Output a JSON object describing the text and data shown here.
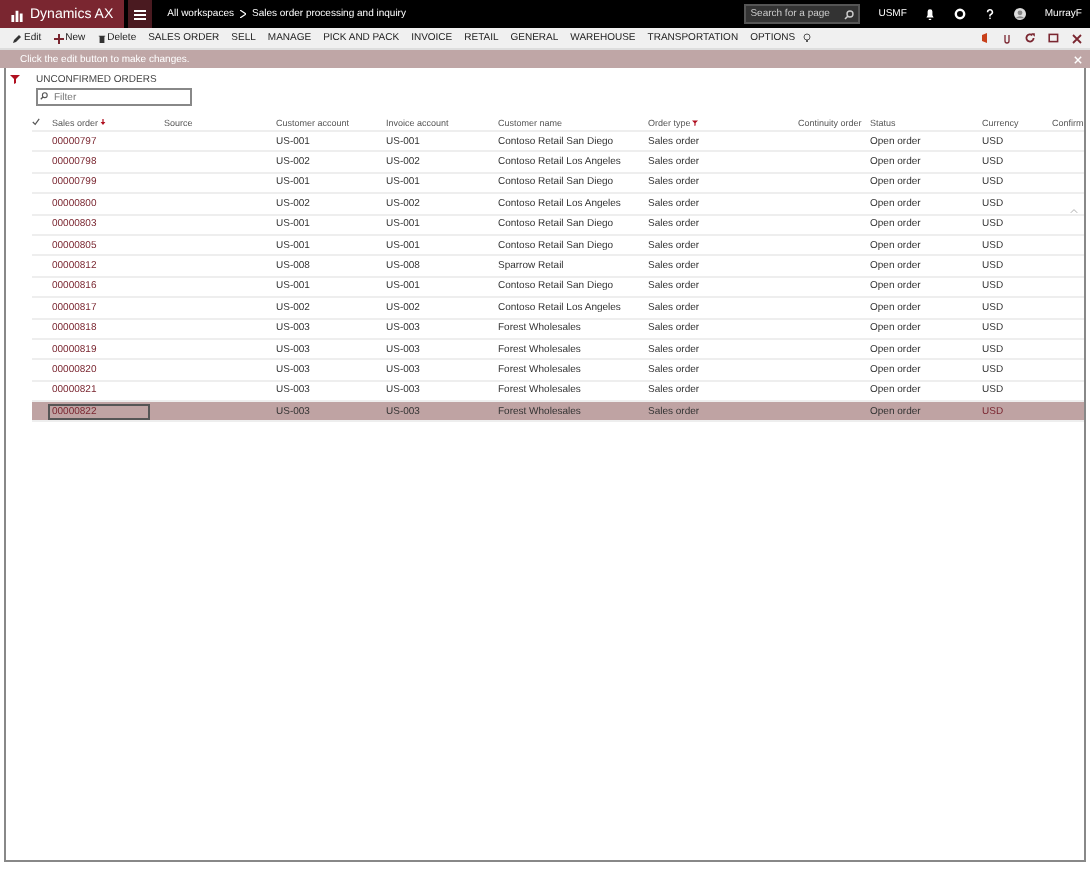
{
  "app": {
    "title": "Dynamics AX"
  },
  "breadcrumb": [
    "All workspaces",
    "Sales order processing and inquiry"
  ],
  "search": {
    "placeholder": "Search for a page"
  },
  "company": "USMF",
  "user": "MurrayF",
  "actions": [
    {
      "label": "Edit",
      "kind": "edit"
    },
    {
      "label": "New",
      "kind": "new"
    },
    {
      "label": "Delete",
      "kind": "delete"
    },
    {
      "label": "SALES ORDER",
      "kind": "menu"
    },
    {
      "label": "SELL",
      "kind": "menu"
    },
    {
      "label": "MANAGE",
      "kind": "menu"
    },
    {
      "label": "PICK AND PACK",
      "kind": "menu"
    },
    {
      "label": "INVOICE",
      "kind": "menu"
    },
    {
      "label": "RETAIL",
      "kind": "menu"
    },
    {
      "label": "GENERAL",
      "kind": "menu"
    },
    {
      "label": "WAREHOUSE",
      "kind": "menu"
    },
    {
      "label": "TRANSPORTATION",
      "kind": "menu"
    },
    {
      "label": "OPTIONS",
      "kind": "menu"
    }
  ],
  "message": "Click the edit button to make changes.",
  "list": {
    "title": "UNCONFIRMED ORDERS",
    "filter_placeholder": "Filter"
  },
  "columns": [
    {
      "label": "Sales order",
      "sorted": true,
      "filtered": false
    },
    {
      "label": "Source",
      "sorted": false,
      "filtered": false
    },
    {
      "label": "Customer account",
      "sorted": false,
      "filtered": false
    },
    {
      "label": "Invoice account",
      "sorted": false,
      "filtered": false
    },
    {
      "label": "Customer name",
      "sorted": false,
      "filtered": false
    },
    {
      "label": "Order type",
      "sorted": false,
      "filtered": true
    },
    {
      "label": "Continuity order",
      "sorted": false,
      "filtered": false
    },
    {
      "label": "Status",
      "sorted": false,
      "filtered": false
    },
    {
      "label": "Currency",
      "sorted": false,
      "filtered": false
    },
    {
      "label": "Confirm",
      "sorted": false,
      "filtered": false
    }
  ],
  "rows": [
    {
      "order": "00000797",
      "customer": "US-001",
      "invoice": "US-001",
      "name": "Contoso Retail San Diego",
      "type": "Sales order",
      "status": "Open order",
      "currency": "USD",
      "selected": false
    },
    {
      "order": "00000798",
      "customer": "US-002",
      "invoice": "US-002",
      "name": "Contoso Retail Los Angeles",
      "type": "Sales order",
      "status": "Open order",
      "currency": "USD",
      "selected": false
    },
    {
      "order": "00000799",
      "customer": "US-001",
      "invoice": "US-001",
      "name": "Contoso Retail San Diego",
      "type": "Sales order",
      "status": "Open order",
      "currency": "USD",
      "selected": false
    },
    {
      "order": "00000800",
      "customer": "US-002",
      "invoice": "US-002",
      "name": "Contoso Retail Los Angeles",
      "type": "Sales order",
      "status": "Open order",
      "currency": "USD",
      "selected": false
    },
    {
      "order": "00000803",
      "customer": "US-001",
      "invoice": "US-001",
      "name": "Contoso Retail San Diego",
      "type": "Sales order",
      "status": "Open order",
      "currency": "USD",
      "selected": false
    },
    {
      "order": "00000805",
      "customer": "US-001",
      "invoice": "US-001",
      "name": "Contoso Retail San Diego",
      "type": "Sales order",
      "status": "Open order",
      "currency": "USD",
      "selected": false
    },
    {
      "order": "00000812",
      "customer": "US-008",
      "invoice": "US-008",
      "name": "Sparrow Retail",
      "type": "Sales order",
      "status": "Open order",
      "currency": "USD",
      "selected": false
    },
    {
      "order": "00000816",
      "customer": "US-001",
      "invoice": "US-001",
      "name": "Contoso Retail San Diego",
      "type": "Sales order",
      "status": "Open order",
      "currency": "USD",
      "selected": false
    },
    {
      "order": "00000817",
      "customer": "US-002",
      "invoice": "US-002",
      "name": "Contoso Retail Los Angeles",
      "type": "Sales order",
      "status": "Open order",
      "currency": "USD",
      "selected": false
    },
    {
      "order": "00000818",
      "customer": "US-003",
      "invoice": "US-003",
      "name": "Forest Wholesales",
      "type": "Sales order",
      "status": "Open order",
      "currency": "USD",
      "selected": false
    },
    {
      "order": "00000819",
      "customer": "US-003",
      "invoice": "US-003",
      "name": "Forest Wholesales",
      "type": "Sales order",
      "status": "Open order",
      "currency": "USD",
      "selected": false
    },
    {
      "order": "00000820",
      "customer": "US-003",
      "invoice": "US-003",
      "name": "Forest Wholesales",
      "type": "Sales order",
      "status": "Open order",
      "currency": "USD",
      "selected": false
    },
    {
      "order": "00000821",
      "customer": "US-003",
      "invoice": "US-003",
      "name": "Forest Wholesales",
      "type": "Sales order",
      "status": "Open order",
      "currency": "USD",
      "selected": false
    },
    {
      "order": "00000822",
      "customer": "US-003",
      "invoice": "US-003",
      "name": "Forest Wholesales",
      "type": "Sales order",
      "status": "Open order",
      "currency": "USD",
      "selected": true
    }
  ]
}
